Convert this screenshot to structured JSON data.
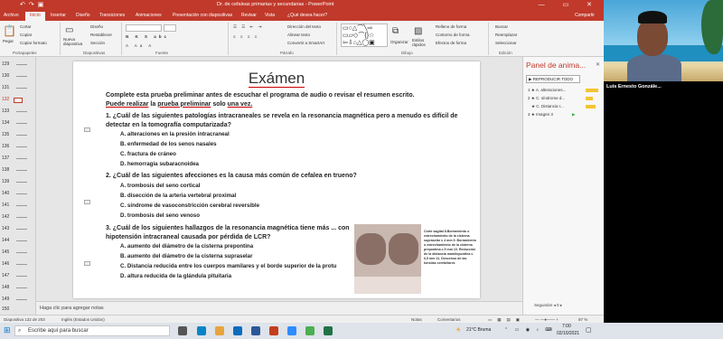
{
  "window": {
    "title": "Dr. de cefaleas primarias y secundarias - PowerPoint",
    "controls": "— ▭ ✕"
  },
  "ribbon_tabs": [
    "Archivo",
    "Inicio",
    "Insertar",
    "Diseño",
    "Transiciones",
    "Animaciones",
    "Presentación con diapositivas",
    "Revisar",
    "Vista",
    "¿Qué desea hacer?",
    "Compartir"
  ],
  "ribbon": {
    "clipboard": {
      "paste": "Pegar",
      "cut": "Cortar",
      "copy": "Copiar",
      "format": "Copiar formato",
      "group": "Portapapeles"
    },
    "slides": {
      "new": "Nueva diapositiva",
      "layout": "Diseño",
      "reset": "Restablecer",
      "section": "Sección",
      "group": "Diapositivas"
    },
    "font": {
      "group": "Fuente"
    },
    "paragraph": {
      "direction": "Dirección del texto",
      "align": "Alinear texto",
      "smartart": "Convertir a SmartArt",
      "group": "Párrafo"
    },
    "drawing": {
      "arrange": "Organizar",
      "styles": "Estilos rápidos",
      "fill": "Relleno de forma",
      "outline": "Contorno de forma",
      "effects": "Efectos de forma",
      "group": "Dibujo"
    },
    "editing": {
      "find": "Buscar",
      "replace": "Reemplazar",
      "select": "Seleccionar",
      "group": "Edición"
    }
  },
  "thumbnails": [
    "129",
    "130",
    "131",
    "132",
    "133",
    "134",
    "135",
    "136",
    "137",
    "138",
    "139",
    "140",
    "141",
    "142",
    "143",
    "144",
    "145",
    "146",
    "147",
    "148",
    "149",
    "150"
  ],
  "selected_slide": "132",
  "slide": {
    "title": "Exámen",
    "intro_1": "Complete esta prueba preliminar antes de escuchar el programa de audio o revisar el resumen escrito.",
    "intro_2a": "Puede realizar",
    "intro_2b": "la",
    "intro_2c": "prueba preliminar",
    "intro_2d": "solo",
    "intro_2e": "una vez.",
    "q1": "1. ¿Cuál de las siguientes patologías intracraneales se revela en la resonancia magnética pero a menudo es difícil de detectar en la tomografía computarizada?",
    "q1_options": [
      "A. alteraciones en la presión intracraneal",
      "B. enfermedad de los senos nasales",
      "C. fractura de cráneo",
      "D. hemorragia subaracnoidea"
    ],
    "q2": "2. ¿Cuál de las siguientes afecciones es la causa más común de cefalea en trueno?",
    "q2_options": [
      "A. trombosis del seno cortical",
      "B. disección de la arteria vertebral proximal",
      "C. síndrome de vasoconstricción cerebral reversible",
      "D. trombosis del seno venoso"
    ],
    "q3": "3. ¿Cuál de los siguientes hallazgos de la resonancia magnética tiene más ... con hipotensión intracraneal causada por pérdida de LCR?",
    "q3_options": [
      "A. aumento del diámetro de la cisterna prepontina",
      "B. aumento del diámetro de la cisterna supraselar",
      "C. Distancia reducida entre los cuerpos mamilares y el borde superior de la protu",
      "D. altura reducida de la glándula pituitaria"
    ],
    "caption": "Corte sagital 8.Borramiento o estrechamiento de la cisterna supraselar ≤ 4 mm 9. Borramiento o estrechamiento de la cisterna prepontina ≤ 5 mm 10. Reducción de la distancia mamilopontina ≤ 6,5 mm 11. Descenso de las tonsilas cerebelares"
  },
  "notes_placeholder": "Haga clic para agregar notas",
  "animation_pane": {
    "title": "Panel de anima...",
    "play_all": "REPRODUCIR TODO",
    "items": [
      {
        "num": "1",
        "label": "A. alteraciones...",
        "color": "#f4c431"
      },
      {
        "num": "2",
        "label": "C. síndrome d...",
        "color": "#f4c431"
      },
      {
        "num": "",
        "label": "C. Distancia r...",
        "color": "#f4c431"
      },
      {
        "num": "4",
        "label": "Imagen 3",
        "color": "#3aa845"
      }
    ],
    "seconds_label": "Segundos",
    "seconds_value": "0"
  },
  "status": {
    "slide_of": "Diapositiva 132 de 203",
    "language": "Inglés (Estados Unidos)",
    "notes": "Notas",
    "comments": "Comentarios",
    "zoom": "87 %"
  },
  "taskbar": {
    "search_placeholder": "Escribe aquí para buscar",
    "weather": "21°C Bruma",
    "time": "7:00",
    "date": "02/10/2021"
  },
  "video": {
    "participant_name": "Luis Ernesto Gonzále..."
  },
  "colors": {
    "accent": "#c0392b",
    "underline": "#cc0000"
  }
}
